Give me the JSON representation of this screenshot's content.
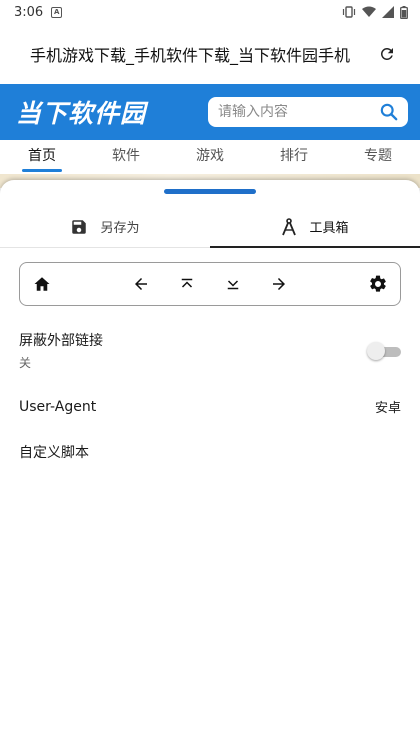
{
  "status_bar": {
    "time": "3:06",
    "notification_icon": "A"
  },
  "address_bar": {
    "page_title": "手机游戏下载_手机软件下载_当下软件园手机"
  },
  "site": {
    "logo_text": "当下软件园",
    "search_placeholder": "请输入内容",
    "brand_color": "#1f7fd8",
    "nav": [
      {
        "label": "首页",
        "active": true
      },
      {
        "label": "软件"
      },
      {
        "label": "游戏"
      },
      {
        "label": "排行"
      },
      {
        "label": "专题"
      }
    ]
  },
  "sheet": {
    "tabs": [
      {
        "label": "另存为",
        "icon": "save-icon"
      },
      {
        "label": "工具箱",
        "icon": "compass-icon",
        "active": true
      }
    ],
    "toolbar": [
      "home-icon",
      "arrow-left-icon",
      "scroll-top-icon",
      "scroll-bottom-icon",
      "arrow-right-icon",
      "gear-icon"
    ],
    "settings": {
      "block_links": {
        "label": "屏蔽外部链接",
        "value": "关",
        "enabled": false
      },
      "user_agent": {
        "label": "User-Agent",
        "value": "安卓"
      },
      "custom_script": {
        "label": "自定义脚本"
      }
    }
  }
}
